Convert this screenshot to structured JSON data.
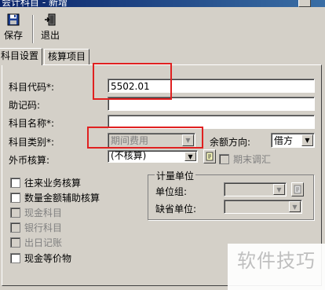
{
  "window": {
    "title": "会计科目 - 新增"
  },
  "toolbar": {
    "save_label": "保存",
    "exit_label": "退出"
  },
  "tabs": [
    {
      "label": "科目设置"
    },
    {
      "label": "核算项目"
    }
  ],
  "form": {
    "code_label": "科目代码*:",
    "code_value": "5502.01",
    "mnemonic_label": "助记码:",
    "mnemonic_value": "",
    "name_label": "科目名称*:",
    "name_value": "",
    "category_label": "科目类别*:",
    "category_value": "期间费用",
    "balance_dir_label": "余额方向:",
    "balance_dir_value": "借方",
    "currency_label": "外币核算:",
    "currency_value": "(不核算)",
    "period_end_label": "期末调汇"
  },
  "checkboxes": [
    {
      "label": "往来业务核算",
      "enabled": true
    },
    {
      "label": "数量金额辅助核算",
      "enabled": true
    },
    {
      "label": "现金科目",
      "enabled": false
    },
    {
      "label": "银行科目",
      "enabled": false
    },
    {
      "label": "出日记账",
      "enabled": false
    },
    {
      "label": "现金等价物",
      "enabled": true
    }
  ],
  "unit_group": {
    "title": "计量单位",
    "group_label": "单位组:",
    "group_value": "",
    "default_label": "缺省单位:",
    "default_value": ""
  },
  "watermark": "软件技巧",
  "colors": {
    "highlight": "#e02020",
    "panel": "#d4d0c8"
  },
  "icons": {
    "save": "floppy-disk",
    "exit": "exit-door",
    "currency_lookup": "document-lookup",
    "unit_lookup": "document-lookup"
  }
}
